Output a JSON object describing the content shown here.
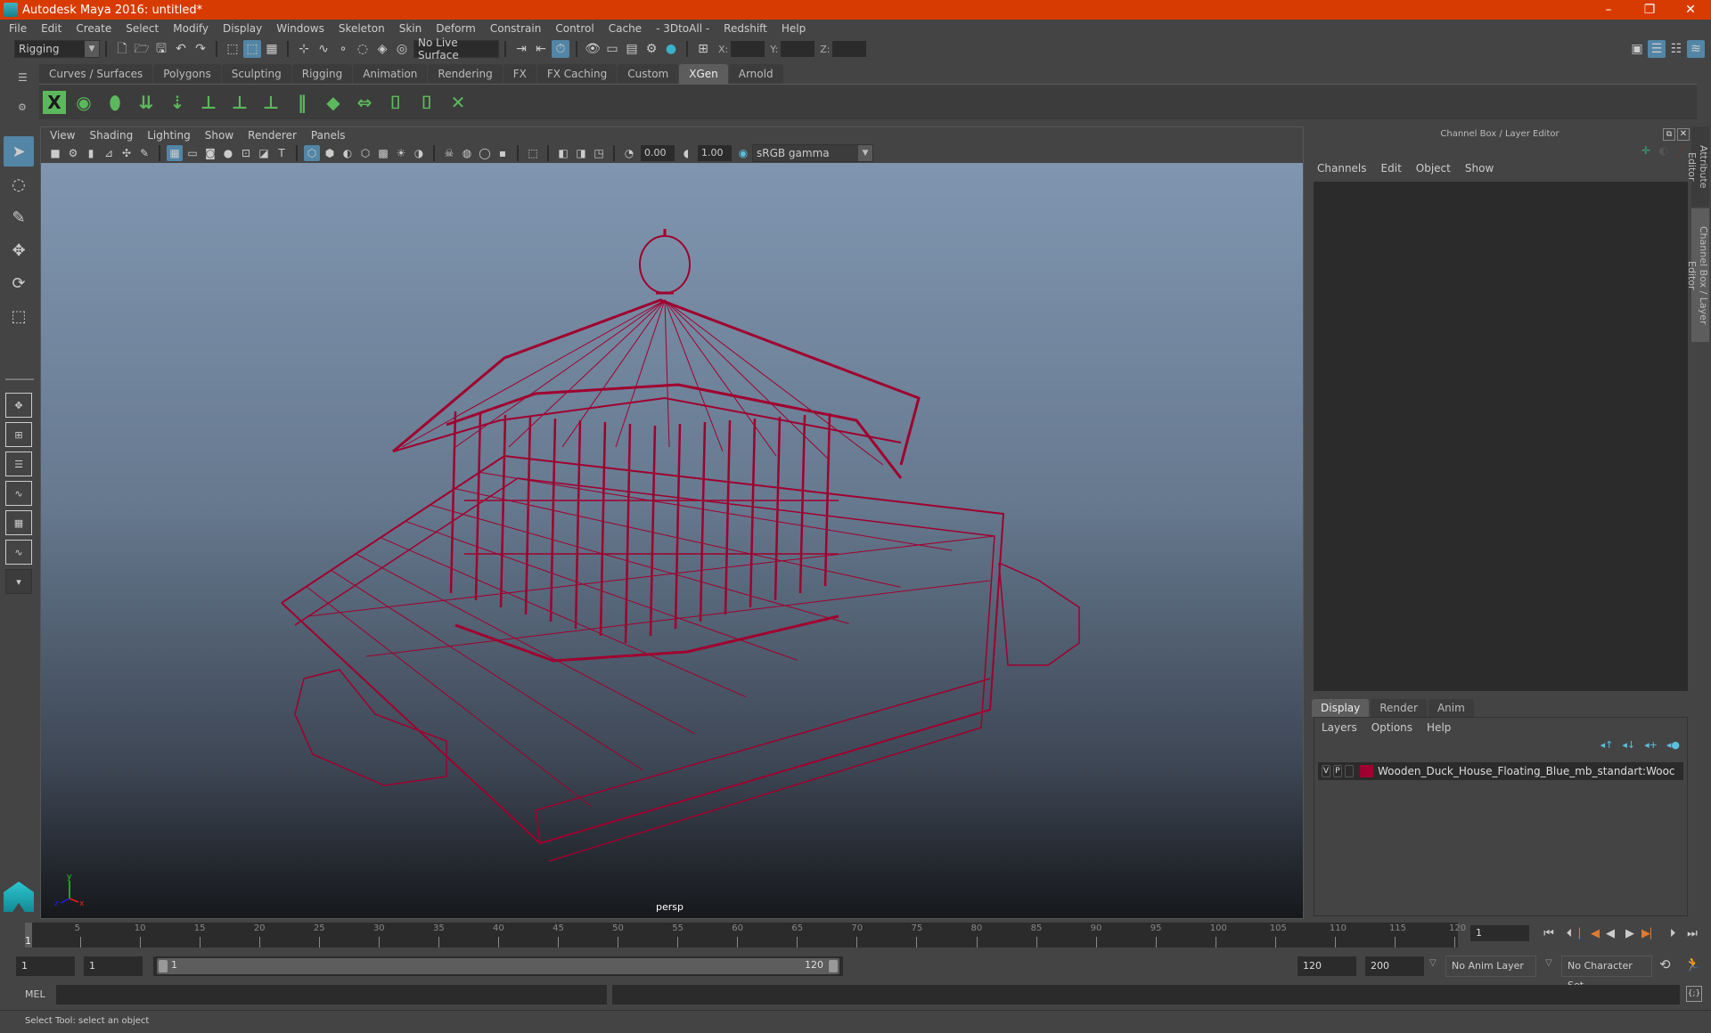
{
  "window": {
    "title": "Autodesk Maya 2016: untitled*",
    "controls": [
      "–",
      "❐",
      "✕"
    ]
  },
  "menubar": [
    "File",
    "Edit",
    "Create",
    "Select",
    "Modify",
    "Display",
    "Windows",
    "Skeleton",
    "Skin",
    "Deform",
    "Constrain",
    "Control",
    "Cache",
    "- 3DtoAll -",
    "Redshift",
    "Help"
  ],
  "statusline": {
    "mode": "Rigging",
    "live_surface": "No Live Surface",
    "x_label": "X:",
    "y_label": "Y:",
    "z_label": "Z:"
  },
  "shelf": {
    "tabs": [
      "Curves / Surfaces",
      "Polygons",
      "Sculpting",
      "Rigging",
      "Animation",
      "Rendering",
      "FX",
      "FX Caching",
      "Custom",
      "XGen",
      "Arnold"
    ],
    "active_tab": "XGen"
  },
  "viewport": {
    "menu": [
      "View",
      "Shading",
      "Lighting",
      "Show",
      "Renderer",
      "Panels"
    ],
    "exposure": "0.00",
    "gamma": "1.00",
    "color_space": "sRGB gamma",
    "camera_label": "persp",
    "wire_color": "#a0002f"
  },
  "channel_box": {
    "title": "Channel Box / Layer Editor",
    "menu": [
      "Channels",
      "Edit",
      "Object",
      "Show"
    ]
  },
  "layer_editor": {
    "tabs": [
      "Display",
      "Render",
      "Anim"
    ],
    "active_tab": "Display",
    "menu": [
      "Layers",
      "Options",
      "Help"
    ],
    "layers": [
      {
        "v": "V",
        "p": "P",
        "color": "#a0002f",
        "name": "Wooden_Duck_House_Floating_Blue_mb_standart:Wooc"
      }
    ]
  },
  "side_tabs": [
    "Attribute Editor",
    "Channel Box / Layer Editor"
  ],
  "timeline": {
    "ticks": [
      5,
      10,
      15,
      20,
      25,
      30,
      35,
      40,
      45,
      50,
      55,
      60,
      65,
      70,
      75,
      80,
      85,
      90,
      95,
      100,
      105,
      110,
      115,
      120
    ],
    "start": 1,
    "end": 120,
    "current_frame": "1"
  },
  "range": {
    "start": "1",
    "anim_start": "1",
    "slider_start": "1",
    "slider_end": "120",
    "end": "120",
    "anim_end": "200",
    "anim_layer": "No Anim Layer",
    "character_set": "No Character Set"
  },
  "command_line": {
    "label": "MEL"
  },
  "status": {
    "help": "Select Tool: select an object"
  }
}
